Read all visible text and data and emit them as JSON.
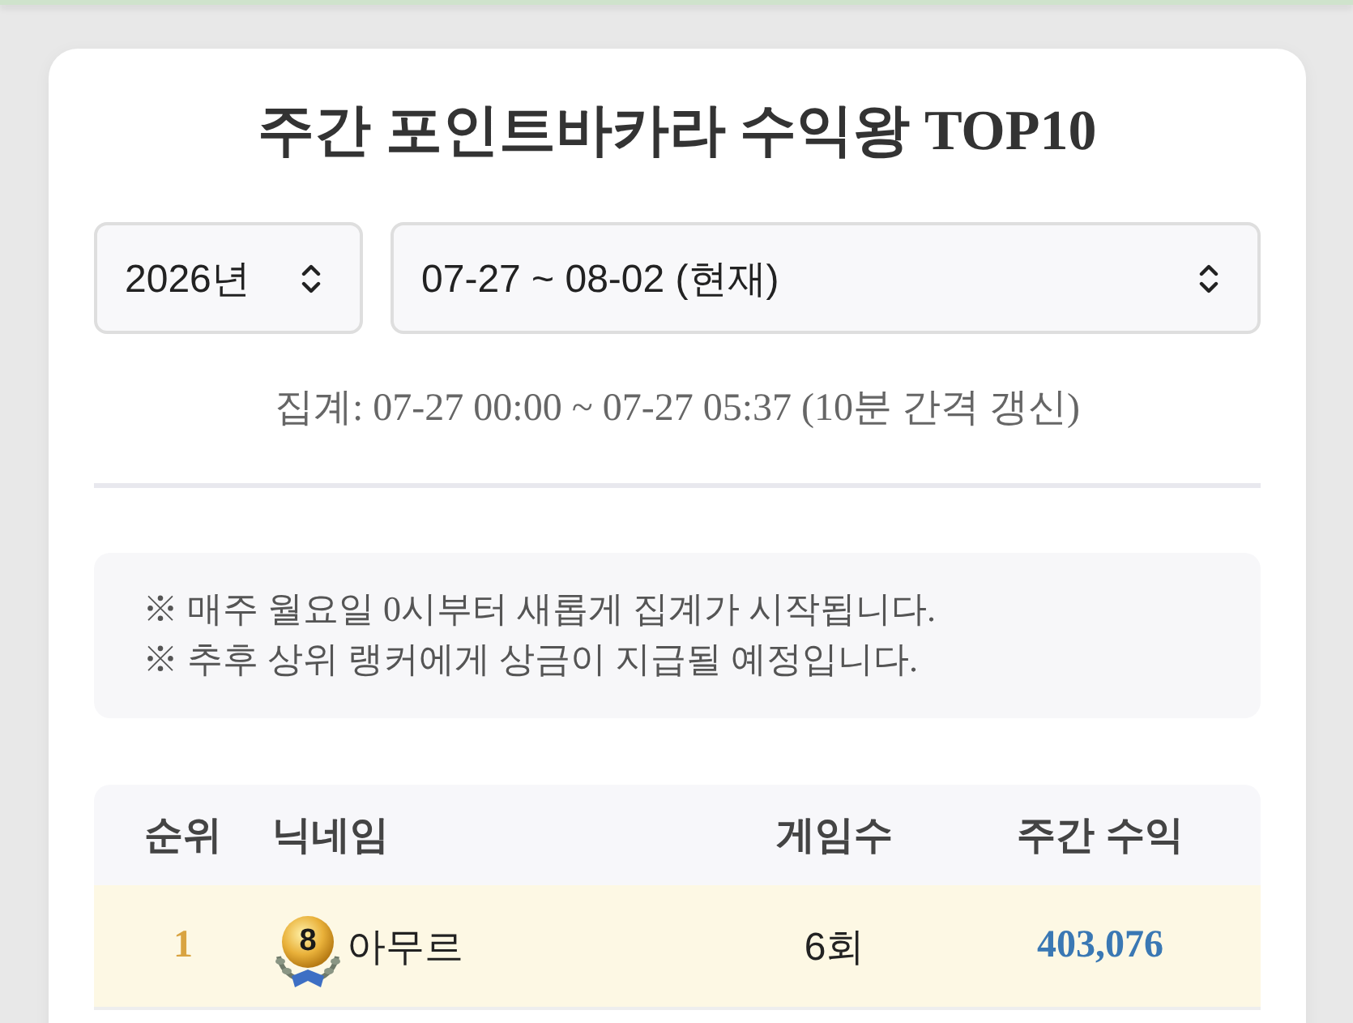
{
  "title": "주간 포인트바카라 수익왕 TOP10",
  "filters": {
    "year": "2026년",
    "week": "07-27 ~ 08-02 (현재)"
  },
  "aggregation": "집계: 07-27 00:00 ~ 07-27 05:37 (10분 간격 갱신)",
  "notices": [
    "※ 매주 월요일 0시부터 새롭게 집계가 시작됩니다.",
    "※ 추후 상위 랭커에게 상금이 지급될 예정입니다."
  ],
  "table": {
    "columns": [
      "순위",
      "닉네임",
      "게임수",
      "주간 수익"
    ],
    "rows": [
      {
        "rank": "1",
        "level_badge": "8",
        "nickname": "아무르",
        "games": "6회",
        "profit": "403,076",
        "highlighted": true
      }
    ]
  }
}
